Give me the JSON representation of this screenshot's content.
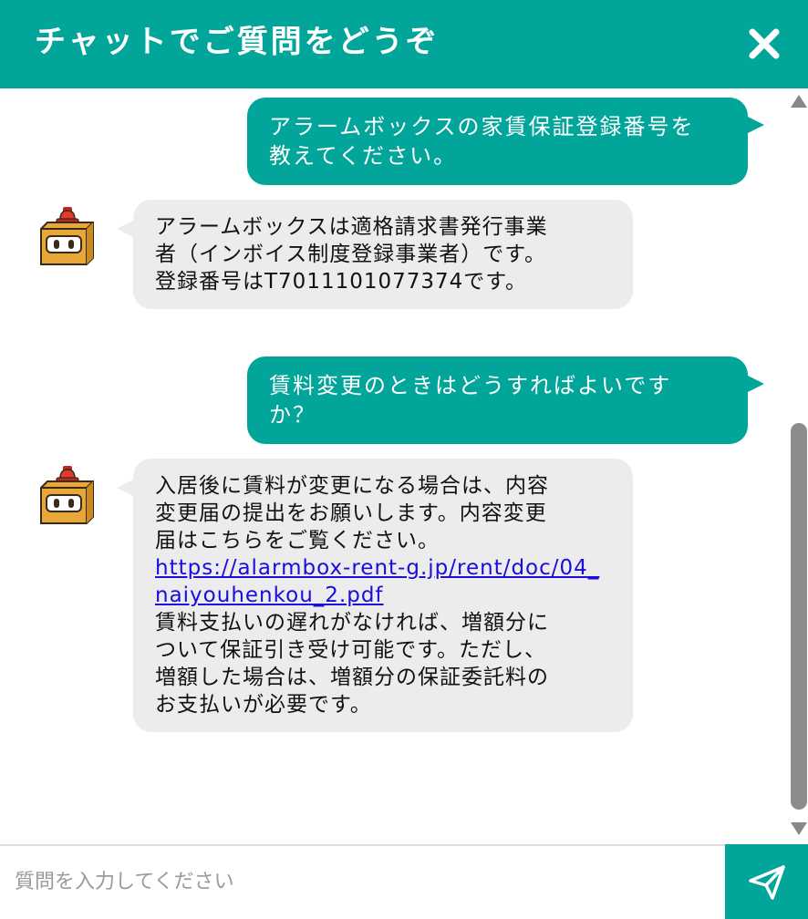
{
  "header": {
    "title": "チャットでご質問をどうぞ"
  },
  "messages": [
    {
      "role": "user",
      "lines": [
        "アラームボックスの家賃保証登録番号を",
        "教えてください。"
      ]
    },
    {
      "role": "bot",
      "lines": [
        "アラームボックスは適格請求書発行事業",
        "者（インボイス制度登録事業者）です。",
        "登録番号はT7011101077374です。"
      ]
    },
    {
      "role": "user",
      "lines": [
        "賃料変更のときはどうすればよいです",
        "か？"
      ]
    },
    {
      "role": "bot",
      "lines_before": [
        "入居後に賃料が変更になる場合は、内容",
        "変更届の提出をお願いします。内容変更",
        "届はこちらをご覧ください。"
      ],
      "link": "https://alarmbox-rent-g.jp/rent/doc/04_naiyouhenkou_2.pdf",
      "lines_after": [
        "賃料支払いの遅れがなければ、増額分に",
        "ついて保証引き受け可能です。ただし、",
        "増額した場合は、増額分の保証委託料の",
        "お支払いが必要です。"
      ]
    }
  ],
  "input": {
    "placeholder": "質問を入力してください",
    "value": ""
  },
  "colors": {
    "brand": "#02a59a",
    "bot_bubble": "#ececec",
    "link": "#1a0ddb",
    "mascot_body": "#e8a838",
    "mascot_lamp": "#e23b2e"
  },
  "icons": {
    "close": "close-icon",
    "send": "paper-plane-icon",
    "avatar": "alarm-box-mascot-icon",
    "scroll_up": "arrow-up-icon",
    "scroll_down": "arrow-down-icon"
  }
}
